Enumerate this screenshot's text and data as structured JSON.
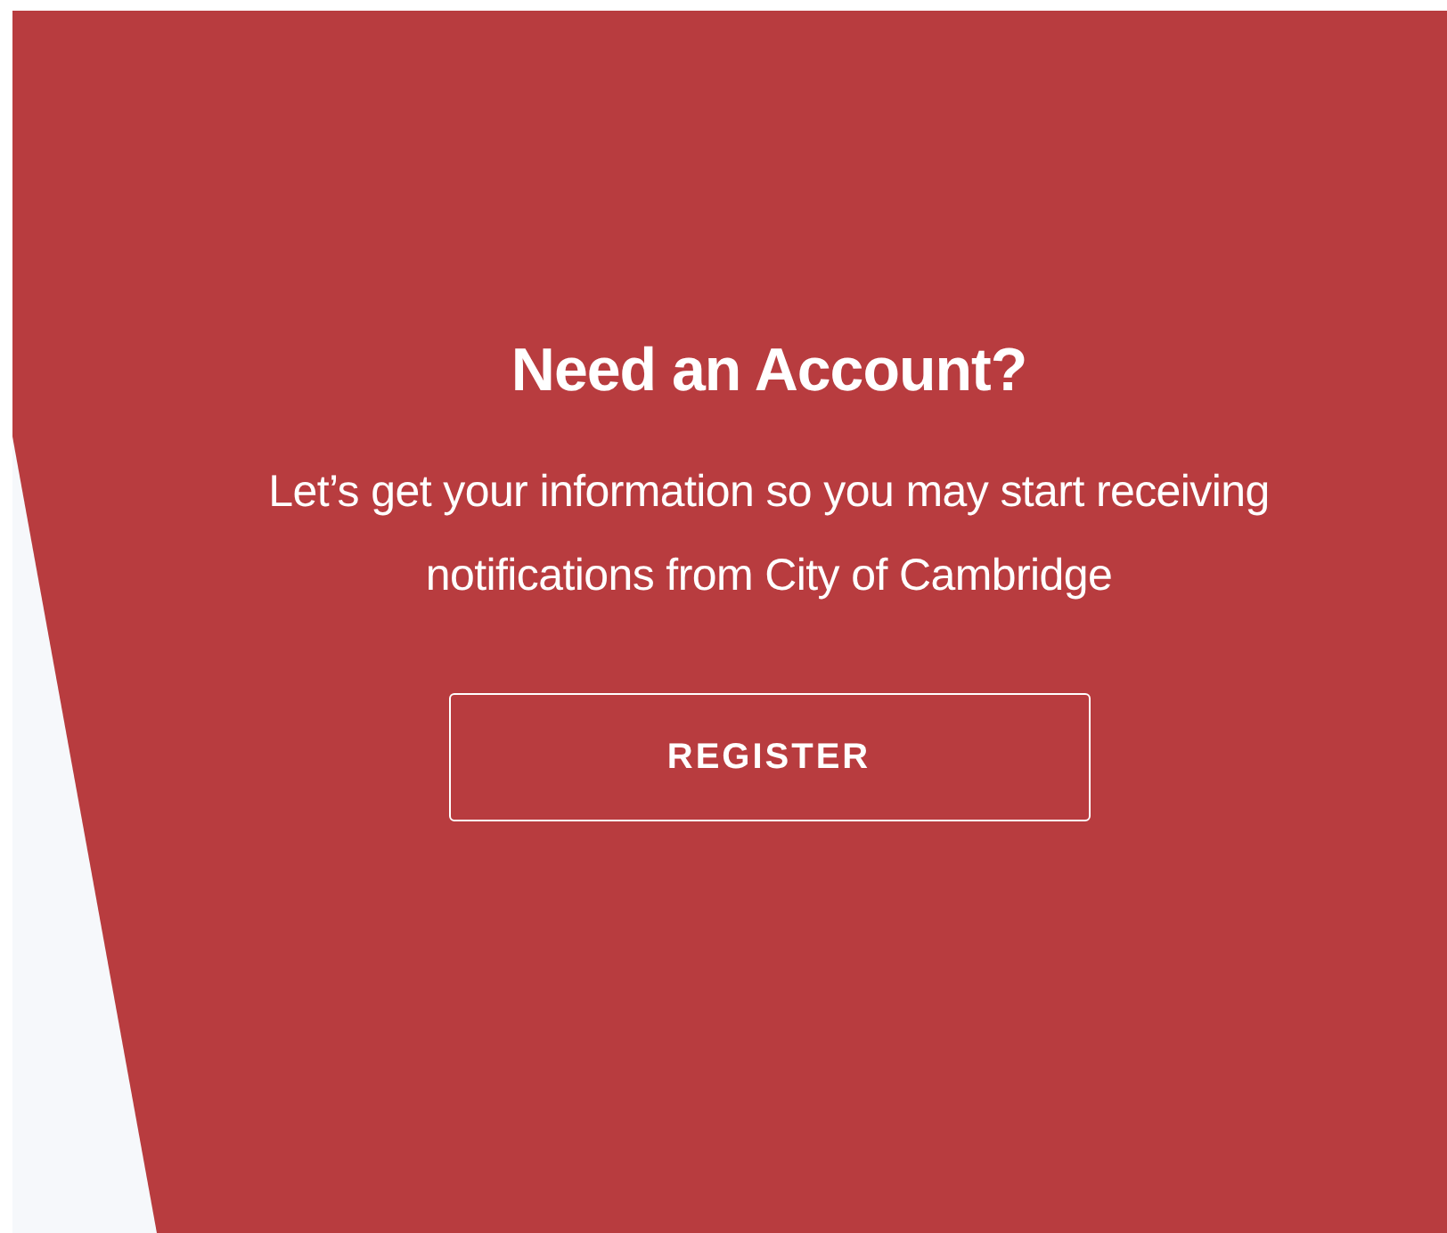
{
  "panel": {
    "title": "Need an Account?",
    "message": "Let’s get your information so you may start receiving notifications from City of Cambridge",
    "button": "REGISTER"
  }
}
